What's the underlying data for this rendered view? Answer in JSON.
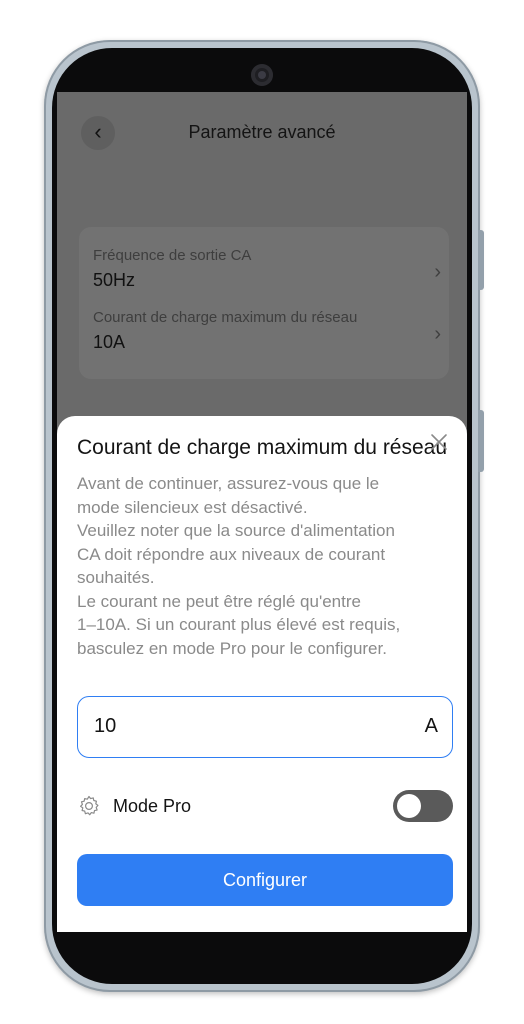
{
  "header": {
    "back_icon": "chevron-left-icon",
    "title": "Paramètre avancé"
  },
  "settings": [
    {
      "label": "Fréquence de sortie CA",
      "value": "50Hz"
    },
    {
      "label": "Courant de charge maximum du réseau",
      "value": "10A"
    }
  ],
  "sheet": {
    "title": "Courant de charge maximum du réseau",
    "description": "Avant de continuer, assurez-vous que le\nmode silencieux est désactivé.\nVeuillez noter que la source d'alimentation\nCA doit répondre aux niveaux de courant\nsouhaités.\nLe courant ne peut être réglé qu'entre\n1–10A. Si un courant plus élevé est requis,\nbasculez en mode Pro pour le configurer.",
    "input_value": "10",
    "input_unit": "A",
    "pro_mode_label": "Mode Pro",
    "pro_mode_enabled": false,
    "configure_label": "Configurer"
  },
  "colors": {
    "accent": "#2f7ef3",
    "overlay": "#6a6a6a",
    "toggle_off": "#5a5a5a"
  }
}
